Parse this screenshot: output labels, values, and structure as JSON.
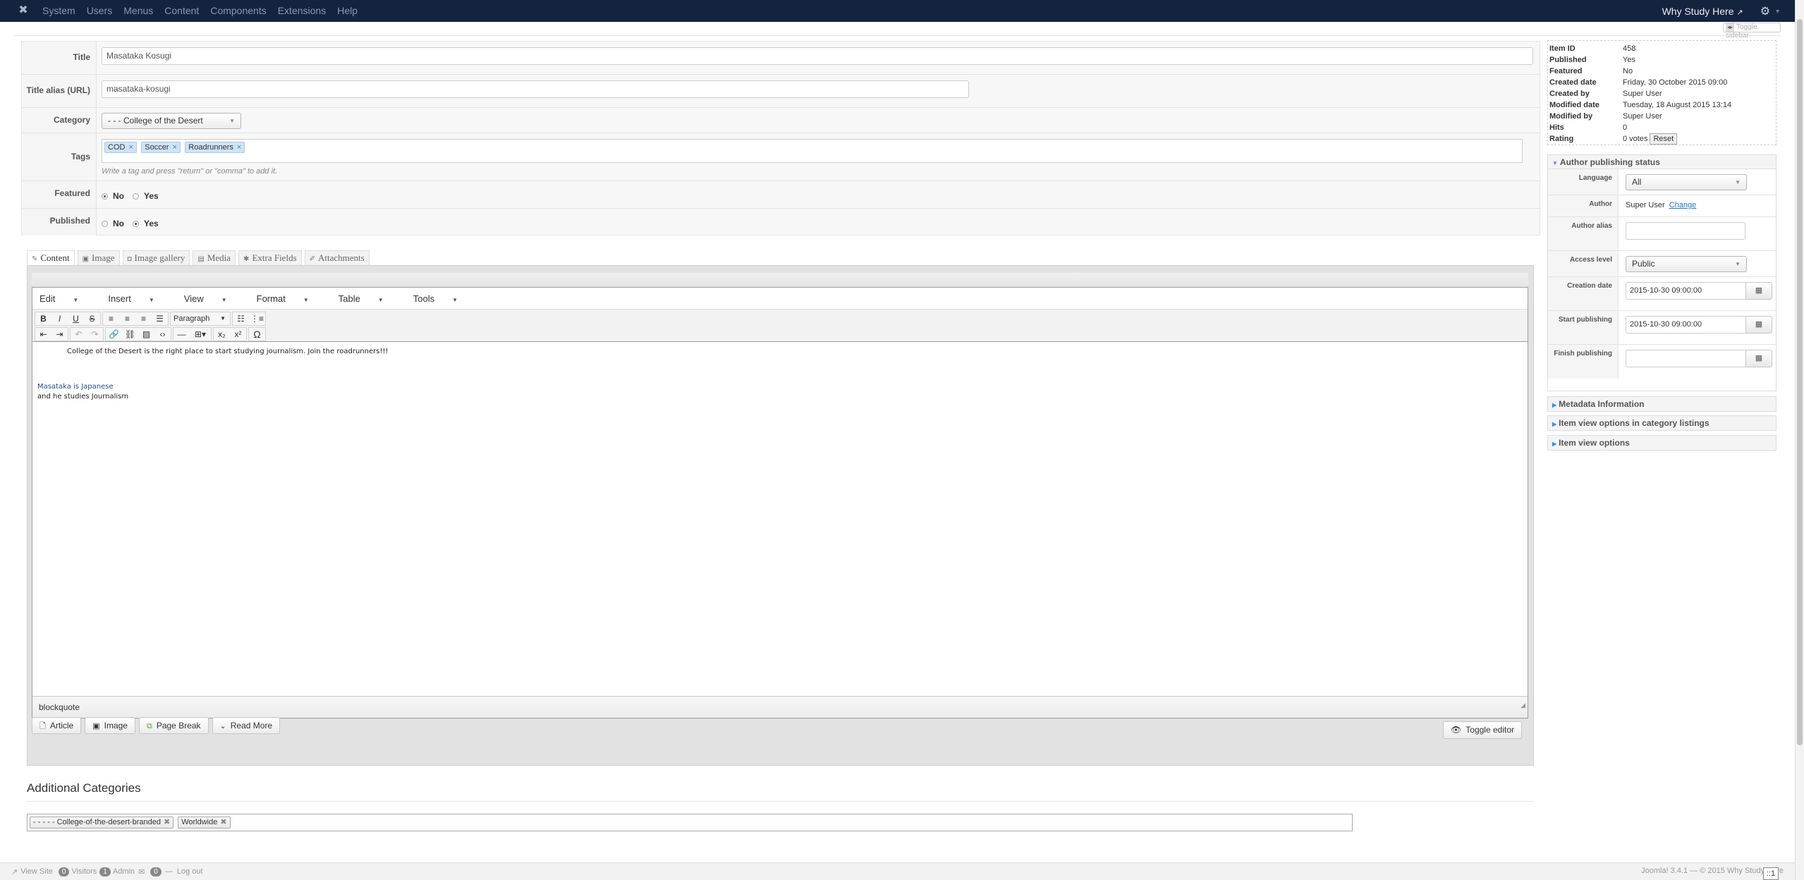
{
  "navbar": {
    "menu": [
      "System",
      "Users",
      "Menus",
      "Content",
      "Components",
      "Extensions",
      "Help"
    ],
    "site_name": "Why Study Here",
    "icons": {
      "logo": "joomla-logo-icon",
      "external": "external-link-icon",
      "settings": "gear-icon"
    }
  },
  "toggle_sidebar_label": "Toggle sidebar",
  "form": {
    "title_label": "Title",
    "title_value": "Masataka Kosugi",
    "alias_label": "Title alias (URL)",
    "alias_value": "masataka-kosugi",
    "category_label": "Category",
    "category_value": "- - - College of the Desert",
    "tags_label": "Tags",
    "tags": [
      "COD",
      "Soccer",
      "Roadrunners"
    ],
    "tags_hint": "Write a tag and press \"return\" or \"comma\" to add it.",
    "featured_label": "Featured",
    "featured_options": [
      "No",
      "Yes"
    ],
    "featured_selected": "No",
    "published_label": "Published",
    "published_options": [
      "No",
      "Yes"
    ],
    "published_selected": "Yes"
  },
  "tabs": [
    {
      "label": "Content",
      "icon": "edit-icon",
      "active": true
    },
    {
      "label": "Image",
      "icon": "image-icon",
      "active": false
    },
    {
      "label": "Image gallery",
      "icon": "camera-icon",
      "active": false
    },
    {
      "label": "Media",
      "icon": "film-icon",
      "active": false
    },
    {
      "label": "Extra Fields",
      "icon": "puzzle-icon",
      "active": false
    },
    {
      "label": "Attachments",
      "icon": "paperclip-icon",
      "active": false
    }
  ],
  "editor": {
    "menubar": [
      "Edit",
      "Insert",
      "View",
      "Format",
      "Table",
      "Tools"
    ],
    "format_select": "Paragraph",
    "body": {
      "para1": "College of the Desert is the right place to start studying journalism. Join the roadrunners!!!",
      "para2": "Masataka is Japanese",
      "para3": "and he studies Journalism"
    },
    "status_path": "blockquote",
    "buttons": [
      "Article",
      "Image",
      "Page Break",
      "Read More"
    ],
    "toggle_editor": "Toggle editor"
  },
  "additional_categories": {
    "title": "Additional Categories",
    "items": [
      "- - - - - College-of-the-desert-branded",
      "Worldwide"
    ]
  },
  "info": {
    "rows": [
      {
        "k": "Item ID",
        "v": "458"
      },
      {
        "k": "Published",
        "v": "Yes"
      },
      {
        "k": "Featured",
        "v": "No"
      },
      {
        "k": "Created date",
        "v": "Friday, 30 October 2015 09:00"
      },
      {
        "k": "Created by",
        "v": "Super User"
      },
      {
        "k": "Modified date",
        "v": "Tuesday, 18 August 2015 13:14"
      },
      {
        "k": "Modified by",
        "v": "Super User"
      },
      {
        "k": "Hits",
        "v": "0"
      },
      {
        "k": "Rating",
        "v": "0 votes"
      }
    ],
    "reset_label": "Reset"
  },
  "publishing": {
    "header": "Author publishing status",
    "language_label": "Language",
    "language_value": "All",
    "author_label": "Author",
    "author_value": "Super User",
    "author_change": "Change",
    "alias_label": "Author alias",
    "alias_value": "",
    "access_label": "Access level",
    "access_value": "Public",
    "creation_label": "Creation date",
    "creation_value": "2015-10-30 09:00:00",
    "start_label": "Start publishing",
    "start_value": "2015-10-30 09:00:00",
    "finish_label": "Finish publishing",
    "finish_value": ""
  },
  "accordions": [
    "Metadata Information",
    "Item view options in category listings",
    "Item view options"
  ],
  "footer": {
    "view_site": "View Site",
    "visitors_count": "0",
    "visitors_label": "Visitors",
    "admin_count": "1",
    "admin_label": "Admin",
    "messages_count": "0",
    "logout": "Log out",
    "version": "Joomla! 3.4.1  —  © 2015 Why Study Here",
    "ip_tooltip": "::1"
  },
  "colors": {
    "navbar": "#14243f",
    "link": "#1e78c8",
    "tag_bg": "#cfe3f7"
  }
}
